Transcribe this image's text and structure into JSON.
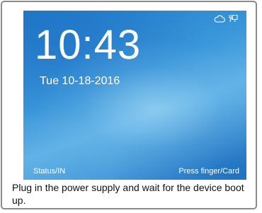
{
  "screen": {
    "time": "10:43",
    "date": "Tue 10-18-2016",
    "status_left": "Status/IN",
    "status_right": "Press finger/Card",
    "icons": [
      "cloud-icon",
      "network-plug-icon"
    ]
  },
  "caption": "Plug in the power supply and wait for the device boot up.",
  "colors": {
    "screen_blue": "#3b98da",
    "frame_border": "#8a8a8a",
    "text_white": "#ffffff"
  }
}
